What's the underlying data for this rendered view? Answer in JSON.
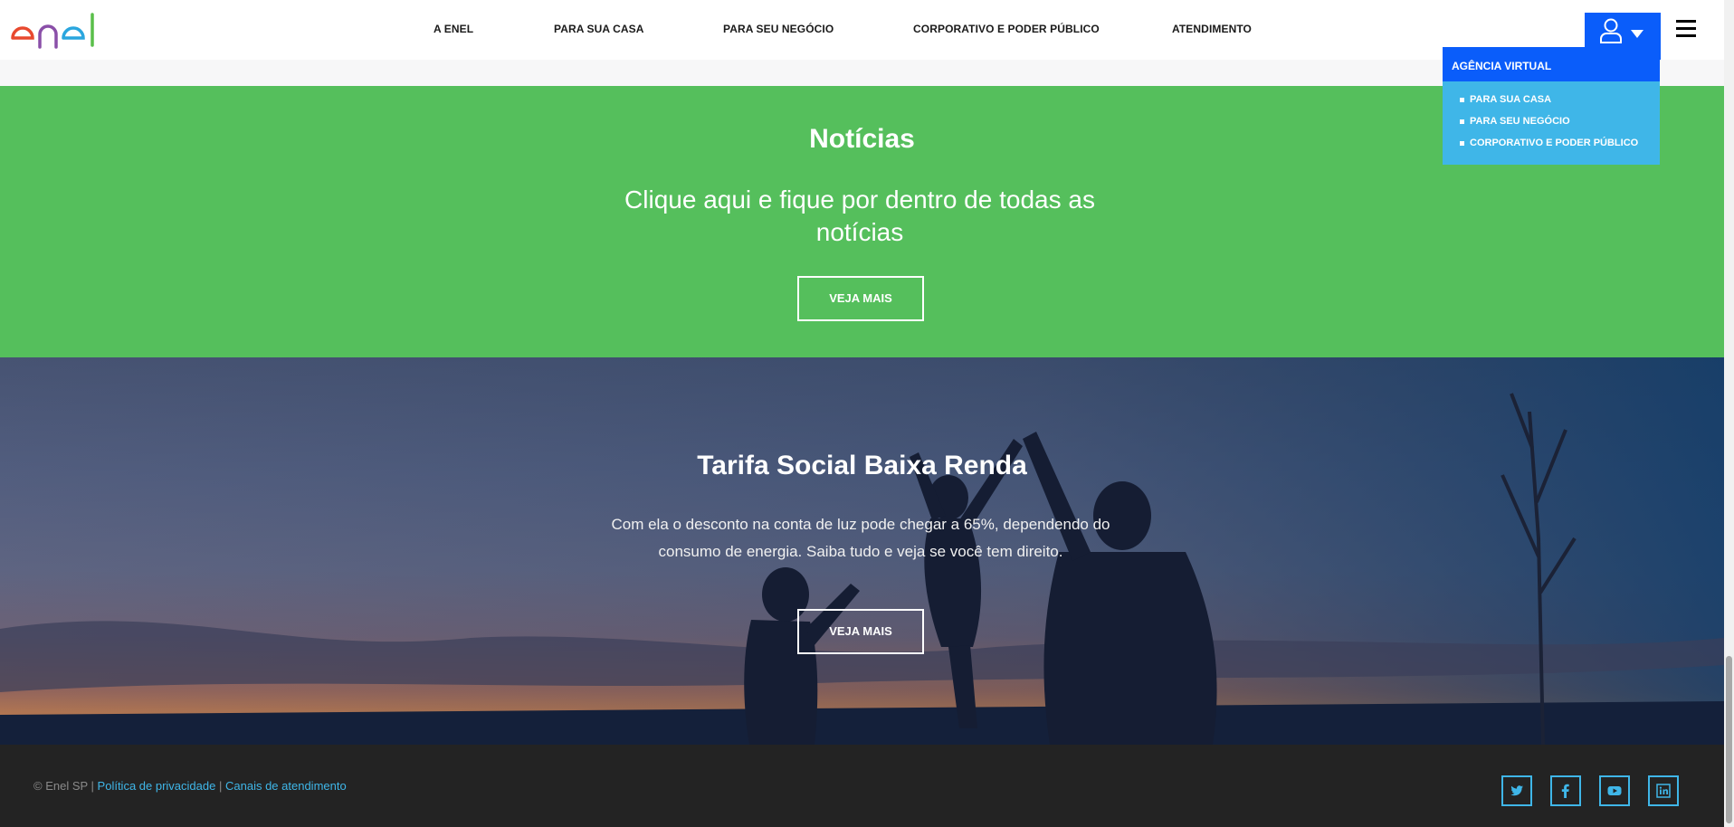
{
  "brand": {
    "logo_text": "enel",
    "accent": "#0a5dfa",
    "secondary": "#3fb6e8",
    "green": "#55bf5c"
  },
  "nav": {
    "items": [
      "A ENEL",
      "PARA SUA CASA",
      "PARA SEU NEGÓCIO",
      "CORPORATIVO E PODER PÚBLICO",
      "ATENDIMENTO"
    ]
  },
  "user_menu": {
    "icon": "user-icon",
    "title": "AGÊNCIA VIRTUAL",
    "items": [
      "PARA SUA CASA",
      "PARA SEU NEGÓCIO",
      "CORPORATIVO E PODER PÚBLICO"
    ]
  },
  "news": {
    "title": "Notícias",
    "subtitle": "Clique aqui e fique por dentro de todas as notícias",
    "button": "VEJA MAIS"
  },
  "tarifa": {
    "title": "Tarifa Social Baixa Renda",
    "text": "Com ela o desconto na conta de luz pode chegar a 65%, dependendo do consumo de energia. Saiba tudo e veja se você tem direito.",
    "button": "VEJA MAIS"
  },
  "footer": {
    "copyright": "© Enel SP |",
    "link_privacy": "Política de privacidade",
    "separator": "|",
    "link_channels": "Canais de atendimento",
    "social": [
      "twitter-icon",
      "facebook-icon",
      "youtube-icon",
      "linkedin-icon"
    ]
  }
}
